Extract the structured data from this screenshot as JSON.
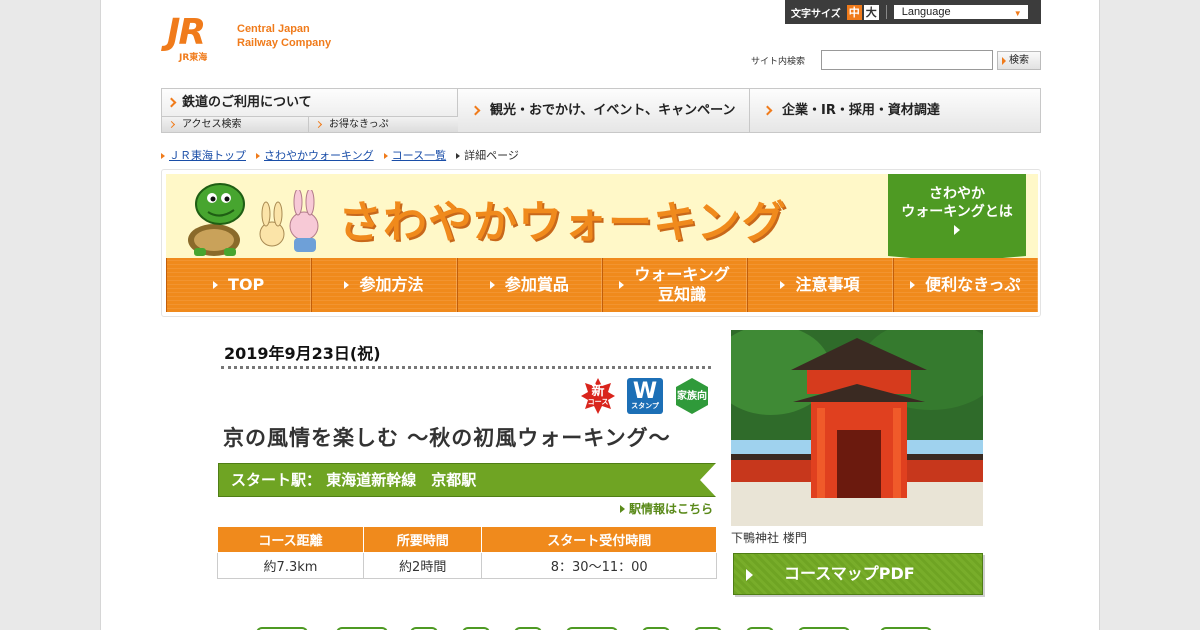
{
  "header": {
    "logo_mark": "JR",
    "logo_sub": "JR東海",
    "company_line1": "Central Japan",
    "company_line2": "Railway Company",
    "font_size_label": "文字サイズ",
    "font_size_mid": "中",
    "font_size_large": "大",
    "language_label": "Language",
    "search_label": "サイト内検索",
    "search_value": "",
    "search_button": "検索"
  },
  "global_nav": {
    "rail_label": "鉄道のご利用について",
    "access_label": "アクセス検索",
    "tickets_label": "お得なきっぷ",
    "tourism_label": "観光・おでかけ、イベント、キャンペーン",
    "corporate_label": "企業・IR・採用・資材調達"
  },
  "breadcrumb": {
    "items": [
      "ＪＲ東海トップ",
      "さわやかウォーキング",
      "コース一覧"
    ],
    "current": "詳細ページ"
  },
  "banner": {
    "title": "さわやかウォーキング",
    "about_line1": "さわやか",
    "about_line2": "ウォーキングとは",
    "nav": [
      {
        "line1": "TOP",
        "line2": ""
      },
      {
        "line1": "参加方法",
        "line2": ""
      },
      {
        "line1": "参加賞品",
        "line2": ""
      },
      {
        "line1": "ウォーキング",
        "line2": "豆知識"
      },
      {
        "line1": "注意事項",
        "line2": ""
      },
      {
        "line1": "便利なきっぷ",
        "line2": ""
      }
    ]
  },
  "detail": {
    "date": "2019年9月23日(祝)",
    "badge_new": "新",
    "badge_new_sub": "コース",
    "badge_w": "W",
    "badge_w_sub": "スタンプ",
    "badge_family": "家族向",
    "title": "京の風情を楽しむ ～秋の初風ウォーキング～",
    "start_station": "スタート駅：  東海道新幹線　京都駅",
    "station_info_link": "駅情報はこちら",
    "table": {
      "headers": [
        "コース距離",
        "所要時間",
        "スタート受付時間"
      ],
      "values": [
        "約7.3km",
        "約2時間",
        "8：30～11：00"
      ]
    },
    "photo_caption": "下鴨神社 楼門",
    "pdf_button": "コースマップPDF"
  },
  "colors": {
    "accent_orange": "#f08a1c",
    "accent_green": "#6fa423",
    "banner_bg": "#fff8c8"
  }
}
